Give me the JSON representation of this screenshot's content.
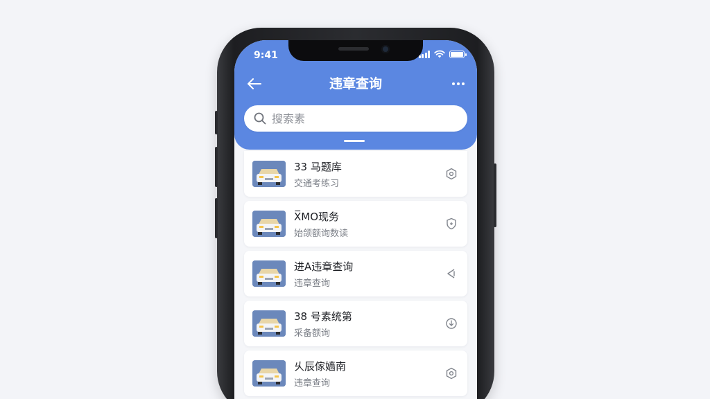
{
  "status_bar": {
    "time": "9:41"
  },
  "header": {
    "title": "违章查询",
    "back_icon": "arrow-left-icon",
    "more_icon": "more-dots-icon",
    "accent_color": "#5b87e1"
  },
  "search": {
    "placeholder": "搜索素"
  },
  "list": {
    "items": [
      {
        "title": "33 马题库",
        "subtitle": "交通考练习",
        "icon": "car-thumbnail",
        "action_icon": "settings-hex-icon"
      },
      {
        "title": "X̅MO现务",
        "subtitle": "始颌额询数读",
        "icon": "car-thumbnail",
        "action_icon": "shield-icon"
      },
      {
        "title": "进A违章查询",
        "subtitle": "违章查询",
        "icon": "car-thumbnail",
        "action_icon": "share-arrow-icon"
      },
      {
        "title": "38 号素统第",
        "subtitle": "采备额询",
        "icon": "car-thumbnail",
        "action_icon": "download-badge-icon"
      },
      {
        "title": "乆辰傢嫱南",
        "subtitle": "违章查询",
        "icon": "car-thumbnail",
        "action_icon": "settings-hex-icon"
      }
    ]
  }
}
